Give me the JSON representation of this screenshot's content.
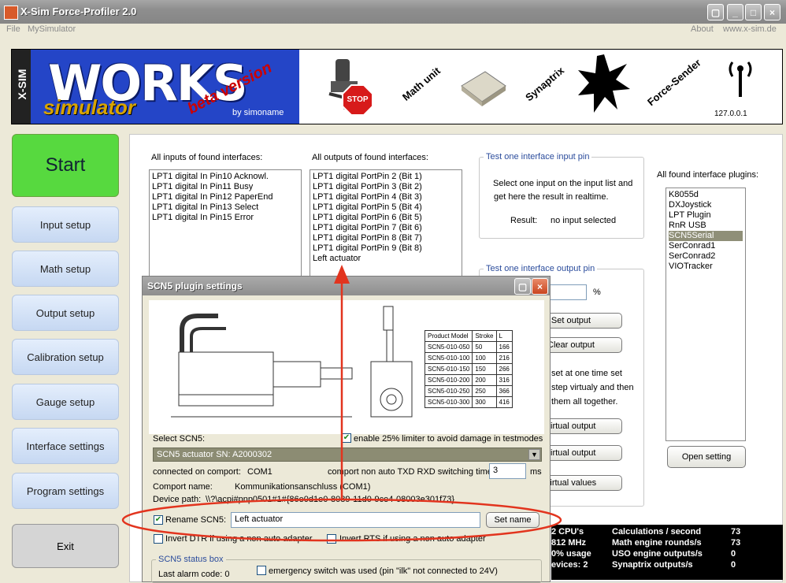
{
  "window": {
    "title": "X-Sim Force-Profiler 2.0"
  },
  "menu": {
    "items": [
      "File",
      "MySimulator"
    ],
    "about": "About",
    "website": "www.x-sim.de"
  },
  "banner": {
    "xsim": "X-SIM",
    "works": "WORKS",
    "simulator": "simulator",
    "beta": "beta version",
    "by": "by simoname",
    "stop": "STOP",
    "math": "Math unit",
    "synaptrix": "Synaptrix",
    "force_sender": "Force-Sender",
    "ip": "127.0.0.1"
  },
  "nav": {
    "start": "Start",
    "input": "Input setup",
    "math": "Math setup",
    "output": "Output setup",
    "calibration": "Calibration setup",
    "gauge": "Gauge setup",
    "interface": "Interface settings",
    "program": "Program settings",
    "exit": "Exit"
  },
  "inputs": {
    "label": "All inputs of found interfaces:",
    "items": [
      "LPT1 digital In Pin10 Acknowl.",
      "LPT1 digital In Pin11 Busy",
      "LPT1 digital In Pin12 PaperEnd",
      "LPT1 digital In Pin13 Select",
      "LPT1 digital In Pin15 Error"
    ]
  },
  "outputs": {
    "label": "All outputs of found interfaces:",
    "items": [
      "LPT1 digital PortPin 2 (Bit 1)",
      "LPT1 digital PortPin 3 (Bit 2)",
      "LPT1 digital PortPin 4 (Bit 3)",
      "LPT1 digital PortPin 5 (Bit 4)",
      "LPT1 digital PortPin 6 (Bit 5)",
      "LPT1 digital PortPin 7 (Bit 6)",
      "LPT1 digital PortPin 8 (Bit 7)",
      "LPT1 digital PortPin 9 (Bit 8)",
      "Left actuator"
    ]
  },
  "test_input": {
    "title": "Test one interface input pin",
    "desc1": "Select one input on the input list and",
    "desc2": "get here the result in realtime.",
    "result_label": "Result:",
    "result_value": "no input selected"
  },
  "test_output": {
    "title": "Test one interface output pin",
    "percent": "%",
    "btn1": "Set output",
    "btn2": "Clear output",
    "text1": "set at one time set",
    "text2": "step virtualy and then",
    "text3": "them all together.",
    "btn3": "virtual output",
    "btn4": "virtual output",
    "btn5": "virtual values"
  },
  "plugins": {
    "label": "All found interface plugins:",
    "items": [
      "K8055d",
      "DXJoystick",
      "LPT Plugin",
      "RnR USB",
      "SCN5Serial",
      "SerConrad1",
      "SerConrad2",
      "VIOTracker"
    ],
    "selected": 4,
    "open_button": "Open setting"
  },
  "dialog": {
    "title": "SCN5 plugin settings",
    "product_table": {
      "headers": [
        "Product Model",
        "Stroke",
        "L"
      ],
      "rows": [
        [
          "SCN5-010-050",
          "50",
          "166"
        ],
        [
          "SCN5-010-100",
          "100",
          "216"
        ],
        [
          "SCN5-010-150",
          "150",
          "266"
        ],
        [
          "SCN5-010-200",
          "200",
          "316"
        ],
        [
          "SCN5-010-250",
          "250",
          "366"
        ],
        [
          "SCN5-010-300",
          "300",
          "416"
        ]
      ]
    },
    "select_label": "Select SCN5:",
    "limiter_label": "enable 25% limiter to avoid damage in testmodes",
    "select_value": "SCN5 actuator SN: A2000302",
    "connected_label": "connected on comport:",
    "connected_value": "COM1",
    "switch_label": "comport non auto TXD RXD switching time",
    "switch_value": "3",
    "switch_unit": "ms",
    "comport_name_label": "Comport name:",
    "comport_name_value": "Kommunikationsanschluss (COM1)",
    "device_path_label": "Device path:",
    "device_path_value": "\\\\?\\acpi#pnp0501#1#{86e0d1e0-8089-11d0-9ce4-08003e301f73}",
    "rename_label": "Rename SCN5:",
    "rename_value": "Left actuator",
    "set_name": "Set name",
    "invert_dtr": "Invert DTR if using a non auto adapter",
    "invert_rts": "Invert RTS if using a non auto adapter",
    "status_title": "SCN5 status box",
    "alarm_label": "Last alarm code: 0",
    "emergency_label": "emergency switch was used (pin \"ilk\" not connected to 24V)"
  },
  "stats": {
    "left": [
      "2 CPU's",
      "812 MHz",
      "0% usage",
      "evices: 2"
    ],
    "labels": [
      "Calculations / second",
      "Math engine rounds/s",
      "USO engine outputs/s",
      "Synaptrix outputs/s"
    ],
    "values": [
      "73",
      "73",
      "0",
      "0"
    ]
  }
}
